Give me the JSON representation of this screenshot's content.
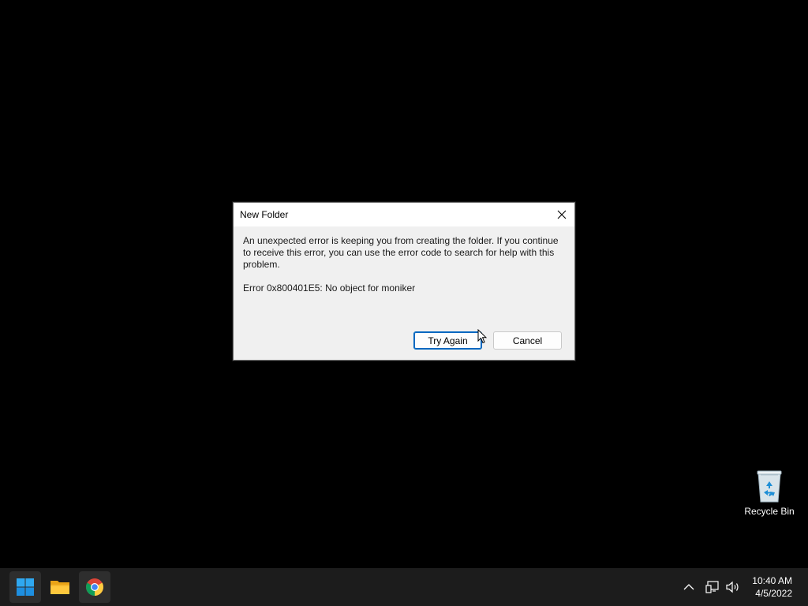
{
  "desktop": {
    "icons": [
      {
        "label": "Recycle Bin",
        "icon": "recycle-bin-icon"
      }
    ]
  },
  "dialog": {
    "title": "New Folder",
    "message": "An unexpected error is keeping you from creating the folder. If you continue to receive this error, you can use the error code to search for help with this problem.",
    "error_code": "Error 0x800401E5: No object for moniker",
    "buttons": {
      "try_again": "Try Again",
      "cancel": "Cancel"
    }
  },
  "taskbar": {
    "pinned": [
      {
        "name": "Start",
        "icon": "windows-start-icon"
      },
      {
        "name": "File Explorer",
        "icon": "file-explorer-icon"
      },
      {
        "name": "Google Chrome",
        "icon": "chrome-icon"
      }
    ],
    "tray": {
      "icons": [
        "chevron-up-icon",
        "network-icon",
        "volume-icon"
      ],
      "time": "10:40 AM",
      "date": "4/5/2022"
    }
  },
  "colors": {
    "accent": "#0067c0",
    "taskbar_bg": "#1c1c1c",
    "dialog_bg": "#f0f0f0"
  }
}
